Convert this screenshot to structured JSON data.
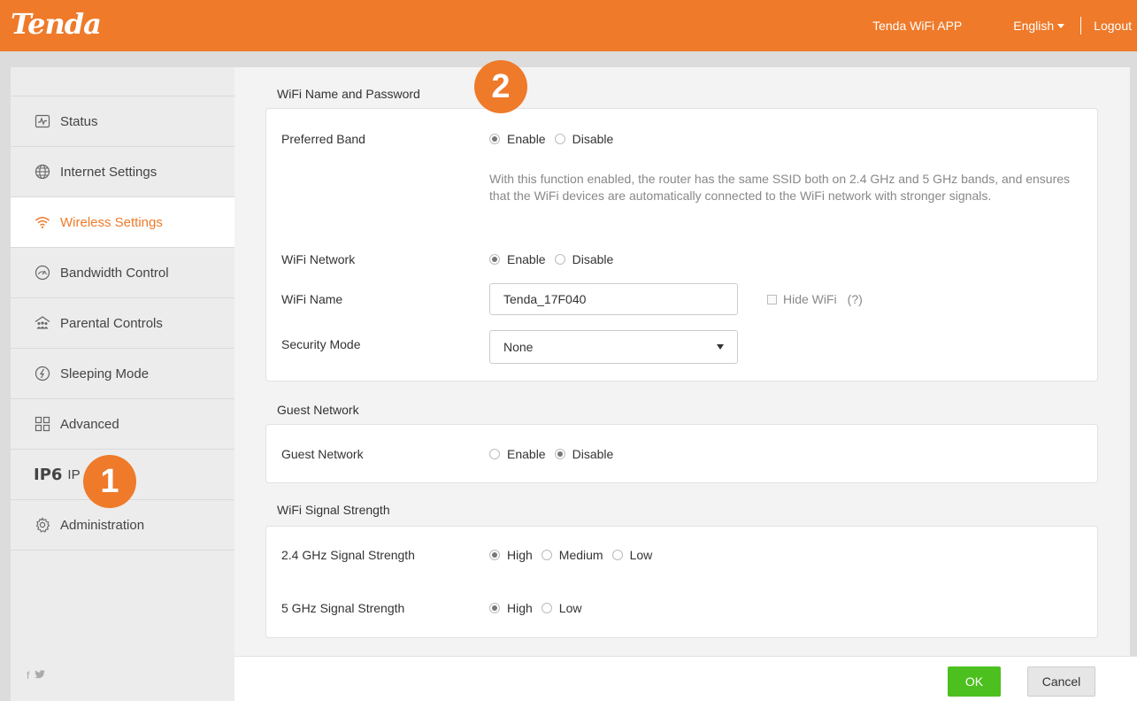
{
  "header": {
    "logo": "Tenda",
    "app_link": "Tenda WiFi APP",
    "language": "English",
    "logout": "Logout"
  },
  "sidebar": {
    "items": [
      {
        "label": "Status",
        "icon": "status-pulse-icon"
      },
      {
        "label": "Internet Settings",
        "icon": "globe-icon"
      },
      {
        "label": "Wireless Settings",
        "icon": "wifi-icon",
        "active": true
      },
      {
        "label": "Bandwidth Control",
        "icon": "gauge-icon"
      },
      {
        "label": "Parental Controls",
        "icon": "family-icon"
      },
      {
        "label": "Sleeping Mode",
        "icon": "sleep-icon"
      },
      {
        "label": "Advanced",
        "icon": "grid-icon"
      },
      {
        "label": "IP",
        "icon_text": "IP6",
        "icon": "ipv6-icon"
      },
      {
        "label": "Administration",
        "icon": "gear-icon"
      }
    ],
    "social": [
      "f",
      "twitter"
    ]
  },
  "wifi_section": {
    "title": "WiFi Name and Password",
    "preferred_band": {
      "label": "Preferred Band",
      "options": [
        "Enable",
        "Disable"
      ],
      "selected": "Enable"
    },
    "description": "With this function enabled, the router has the same SSID both on 2.4 GHz and 5 GHz bands, and ensures that the WiFi devices are automatically connected to the WiFi network with stronger signals.",
    "wifi_network": {
      "label": "WiFi Network",
      "options": [
        "Enable",
        "Disable"
      ],
      "selected": "Enable"
    },
    "wifi_name": {
      "label": "WiFi Name",
      "value": "Tenda_17F040"
    },
    "hide_wifi": {
      "label": "Hide WiFi",
      "help": "(?)",
      "checked": false
    },
    "security_mode": {
      "label": "Security Mode",
      "value": "None"
    }
  },
  "guest_section": {
    "title": "Guest Network",
    "guest_network": {
      "label": "Guest Network",
      "options": [
        "Enable",
        "Disable"
      ],
      "selected": "Disable"
    }
  },
  "signal_section": {
    "title": "WiFi Signal Strength",
    "band24": {
      "label": "2.4 GHz Signal Strength",
      "options": [
        "High",
        "Medium",
        "Low"
      ],
      "selected": "High"
    },
    "band5": {
      "label": "5 GHz Signal Strength",
      "options": [
        "High",
        "Low"
      ],
      "selected": "High"
    }
  },
  "footer": {
    "ok": "OK",
    "cancel": "Cancel"
  },
  "annotations": {
    "badge1": "1",
    "badge2": "2"
  },
  "colors": {
    "brand": "#ee7a2a",
    "ok_button": "#4cc01e"
  }
}
